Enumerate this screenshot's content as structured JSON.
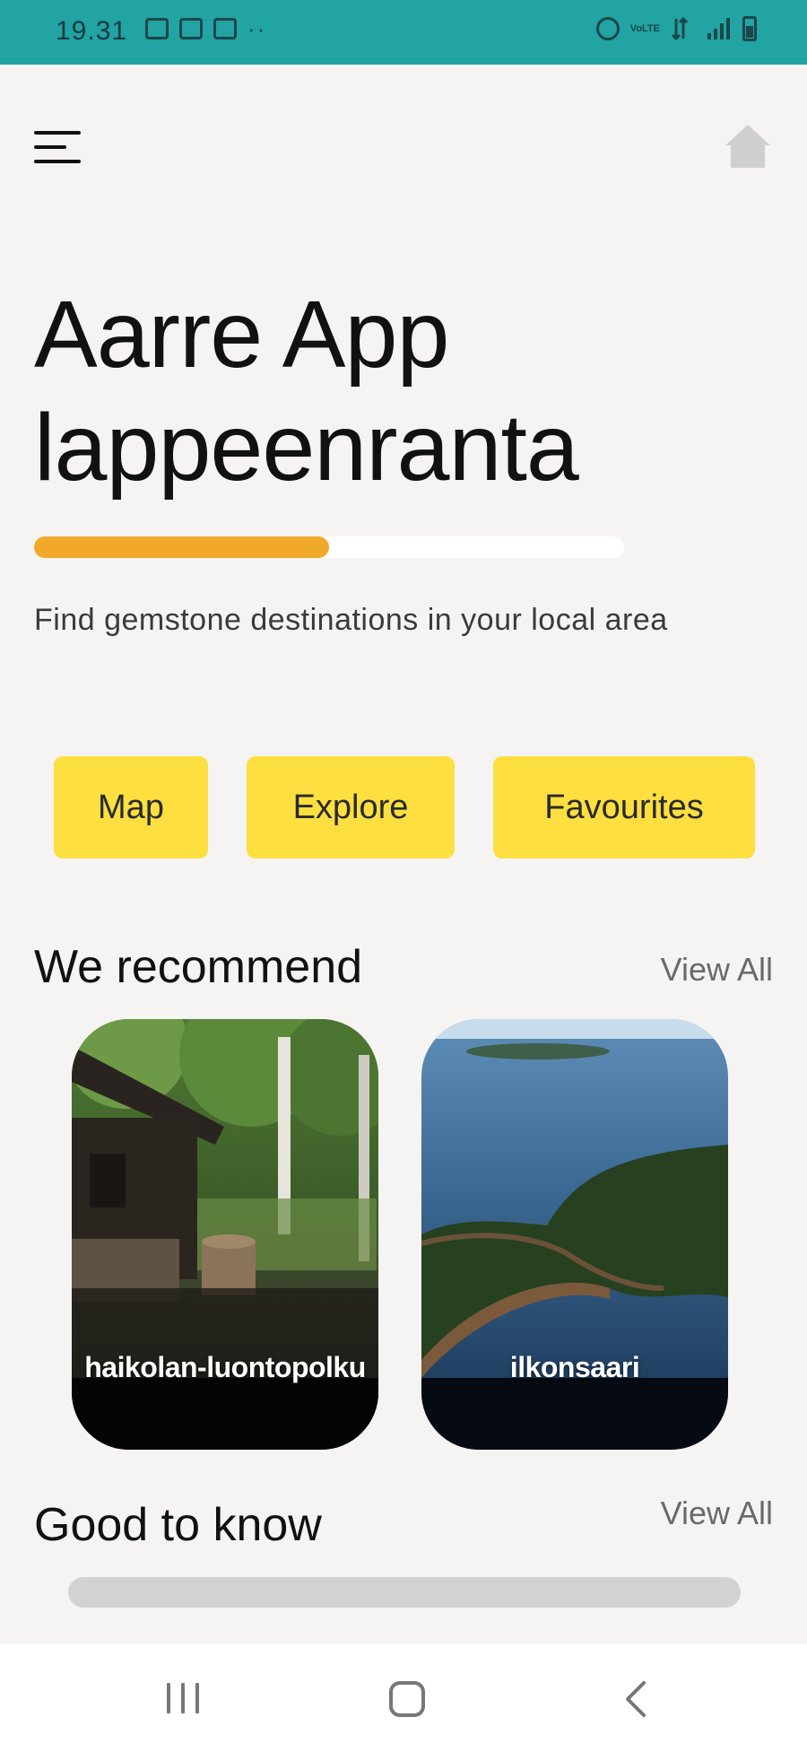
{
  "status_bar": {
    "time": "19.31",
    "left_icons": [
      "teams-icon",
      "gallery-icon",
      "teams-icon"
    ],
    "more": "··",
    "volte": "VoLTE",
    "right_icons": [
      "alarm-icon",
      "volte-icon",
      "data-arrows-icon",
      "signal-icon",
      "battery-icon"
    ]
  },
  "header": {
    "menu_icon": "hamburger-menu-icon",
    "home_icon": "home-icon"
  },
  "hero": {
    "title_line1": "Aarre App",
    "title_line2": "lappeenranta",
    "progress": 0.5,
    "subtitle": "Find gemstone destinations in your local area"
  },
  "actions": {
    "map": "Map",
    "explore": "Explore",
    "favourites": "Favourites"
  },
  "recommend": {
    "title": "We recommend",
    "view_all": "View All",
    "cards": [
      {
        "label": "haikolan-luontopolku"
      },
      {
        "label": "ilkonsaari"
      }
    ]
  },
  "good_to_know": {
    "title": "Good to know",
    "view_all": "View All"
  },
  "nav_bar": {
    "icons": [
      "recents-icon",
      "home-button-icon",
      "back-icon"
    ]
  },
  "colors": {
    "status_bar": "#22a3a4",
    "accent_button": "#fddf40",
    "progress": "#f1a92b",
    "background": "#f5f4f2"
  }
}
